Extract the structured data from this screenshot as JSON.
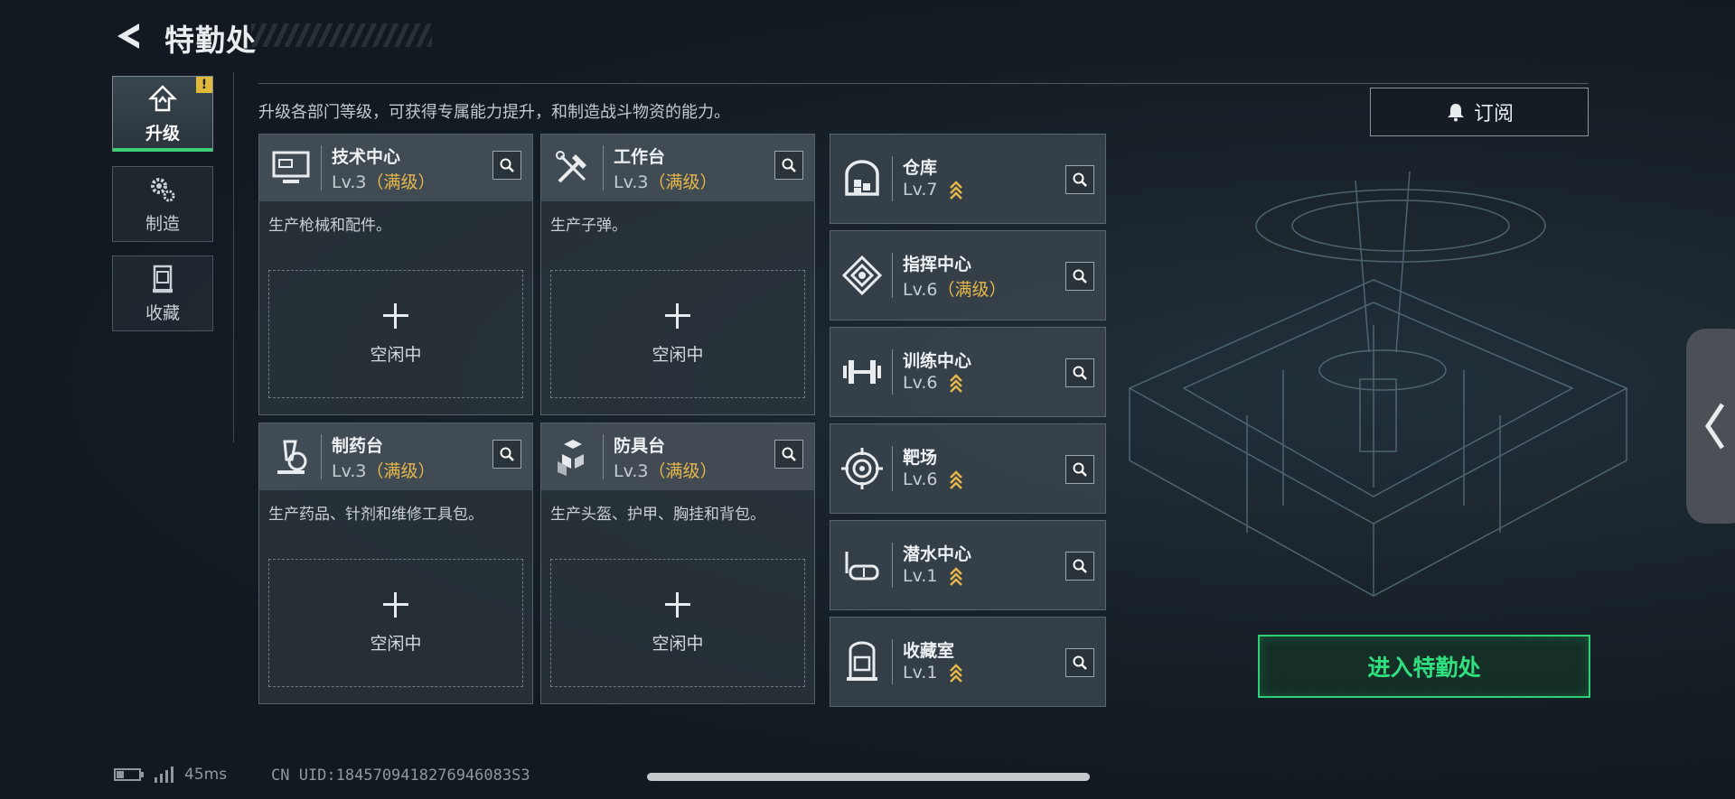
{
  "header": {
    "title": "特勤处"
  },
  "nav": [
    {
      "label": "升级",
      "icon": "upgrade-icon",
      "active": true,
      "alert": "!"
    },
    {
      "label": "制造",
      "icon": "gears-icon",
      "active": false
    },
    {
      "label": "收藏",
      "icon": "collection-icon",
      "active": false
    }
  ],
  "description": "升级各部门等级，可获得专属能力提升，和制造战斗物资的能力。",
  "subscribe_label": "订阅",
  "big_cards": [
    {
      "name": "技术中心",
      "level": "Lv.3",
      "max": "（满级）",
      "desc": "生产枪械和配件。",
      "slot": "空闲中",
      "icon": "monitor-icon"
    },
    {
      "name": "工作台",
      "level": "Lv.3",
      "max": "（满级）",
      "desc": "生产子弹。",
      "slot": "空闲中",
      "icon": "tools-icon"
    },
    {
      "name": "制药台",
      "level": "Lv.3",
      "max": "（满级）",
      "desc": "生产药品、针剂和维修工具包。",
      "slot": "空闲中",
      "icon": "microscope-icon"
    },
    {
      "name": "防具台",
      "level": "Lv.3",
      "max": "（满级）",
      "desc": "生产头盔、护甲、胸挂和背包。",
      "slot": "空闲中",
      "icon": "armor-cubes-icon"
    }
  ],
  "small_cards": [
    {
      "name": "仓库",
      "level": "Lv.7",
      "max": "",
      "upgradable": true,
      "icon": "warehouse-icon"
    },
    {
      "name": "指挥中心",
      "level": "Lv.6",
      "max": "（满级）",
      "upgradable": false,
      "icon": "command-icon"
    },
    {
      "name": "训练中心",
      "level": "Lv.6",
      "max": "",
      "upgradable": true,
      "icon": "dumbbell-icon"
    },
    {
      "name": "靶场",
      "level": "Lv.6",
      "max": "",
      "upgradable": true,
      "icon": "target-icon"
    },
    {
      "name": "潜水中心",
      "level": "Lv.1",
      "max": "",
      "upgradable": true,
      "icon": "diving-mask-icon"
    },
    {
      "name": "收藏室",
      "level": "Lv.1",
      "max": "",
      "upgradable": true,
      "icon": "collection-room-icon"
    }
  ],
  "enter_label": "进入特勤处",
  "status": {
    "ping": "45ms",
    "uid": "CN UID:1845709418276946083S3"
  },
  "colors": {
    "accent_green": "#2fcf73",
    "max_level": "#e5b84a",
    "upgrade_chevron": "#e5b84a"
  }
}
